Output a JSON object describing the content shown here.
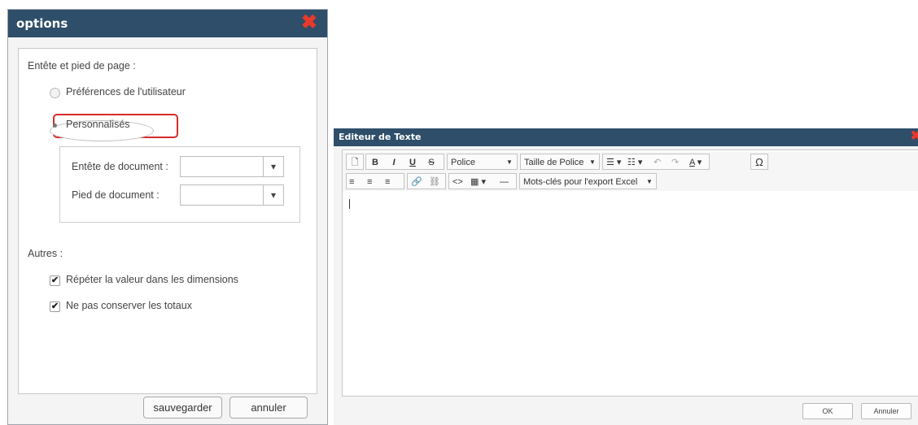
{
  "options_dialog": {
    "title": "options",
    "header_footer_label": "Entête et pied de page :",
    "radio_user_prefs": "Préférences de l'utilisateur",
    "radio_custom": "Personnalisés",
    "doc_header_label": "Entête de document :",
    "doc_footer_label": "Pied de document :",
    "doc_header_value": "",
    "doc_footer_value": "",
    "others_label": "Autres :",
    "check_repeat": "Répéter la valeur dans les dimensions",
    "check_totals": "Ne pas conserver les totaux",
    "save_button": "sauvegarder",
    "cancel_button": "annuler",
    "accent_color": "#2e4e69",
    "highlight_color": "#d62b2b"
  },
  "text_editor": {
    "title": "Editeur de Texte",
    "font_dropdown": "Police",
    "font_size_dropdown": "Taille de Police",
    "keywords_dropdown": "Mots-clés pour l'export Excel",
    "ok_button": "OK",
    "cancel_button": "Annuler"
  }
}
